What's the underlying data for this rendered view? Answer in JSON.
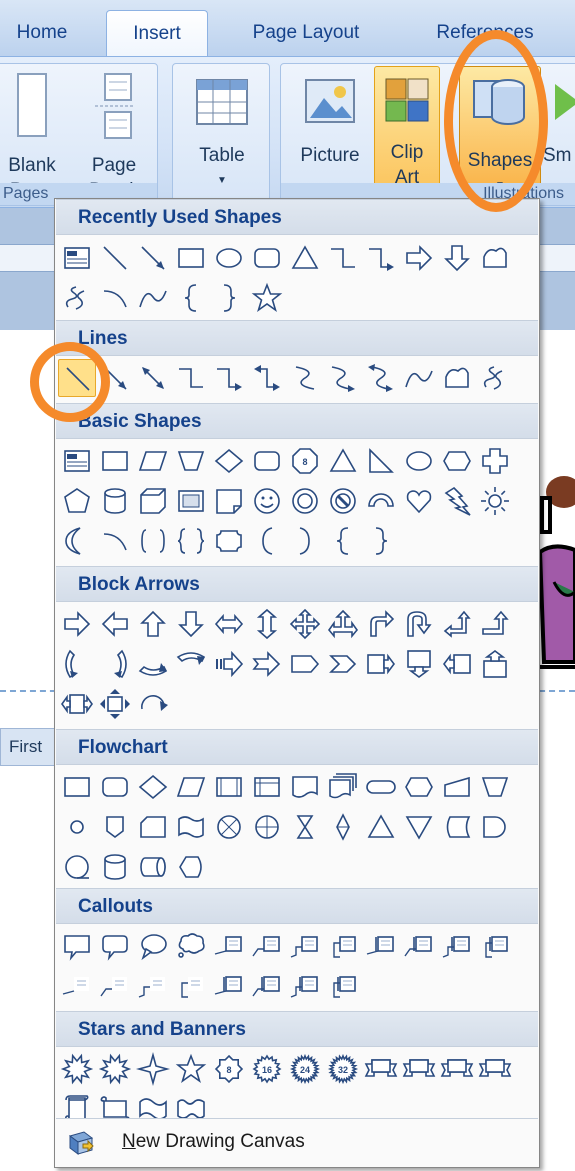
{
  "ribbon_tabs": [
    "Home",
    "Insert",
    "Page Layout",
    "References"
  ],
  "ribbon_groups": {
    "pages": {
      "label": "Pages",
      "buttons": [
        "Blank Page",
        "Page Break"
      ]
    },
    "tables": {
      "button": "Table"
    },
    "illustrations": {
      "label": "Illustrations",
      "buttons": [
        "Picture",
        "Clip Art",
        "Shapes",
        "Sm"
      ]
    }
  },
  "side_tab": "First",
  "shapes_menu": {
    "sections": [
      {
        "title": "Recently Used Shapes",
        "rows": [
          [
            "text-box",
            "line",
            "arrow",
            "rectangle",
            "oval",
            "rounded-rectangle",
            "triangle",
            "elbow-connector",
            "elbow-arrow-connector",
            "right-arrow",
            "down-arrow",
            "freeform"
          ],
          [
            "scribble",
            "arc",
            "curve",
            "left-brace",
            "right-brace",
            "star"
          ]
        ]
      },
      {
        "title": "Lines",
        "rows": [
          [
            "line",
            "arrow",
            "double-arrow",
            "elbow-connector",
            "elbow-arrow-connector",
            "elbow-double-arrow",
            "curved-connector",
            "curved-arrow-connector",
            "curved-double-arrow",
            "curve",
            "freeform",
            "scribble"
          ]
        ]
      },
      {
        "title": "Basic Shapes",
        "rows": [
          [
            "text-box",
            "rectangle",
            "parallelogram",
            "trapezoid",
            "diamond",
            "rounded-rectangle",
            "octagon",
            "isosceles-triangle",
            "right-triangle",
            "oval",
            "hexagon",
            "cross"
          ],
          [
            "pentagon",
            "can",
            "cube",
            "bevel",
            "folded-corner",
            "smiley-face",
            "donut",
            "no-symbol",
            "block-arc",
            "heart",
            "lightning-bolt",
            "sun"
          ],
          [
            "moon",
            "arc",
            "double-bracket",
            "double-brace",
            "plaque",
            "left-bracket",
            "right-bracket",
            "left-brace",
            "right-brace"
          ]
        ]
      },
      {
        "title": "Block Arrows",
        "rows": [
          [
            "right-arrow",
            "left-arrow",
            "up-arrow",
            "down-arrow",
            "left-right-arrow",
            "up-down-arrow",
            "quad-arrow",
            "left-right-up-arrow",
            "bent-arrow",
            "u-turn-arrow",
            "left-up-arrow",
            "bent-up-arrow"
          ],
          [
            "curved-right-arrow",
            "curved-left-arrow",
            "curved-up-arrow",
            "curved-down-arrow",
            "striped-right-arrow",
            "notched-right-arrow",
            "pentagon-arrow",
            "chevron",
            "right-arrow-callout",
            "down-arrow-callout",
            "left-arrow-callout",
            "up-arrow-callout"
          ],
          [
            "left-right-arrow-callout",
            "quad-arrow-callout",
            "circular-arrow"
          ]
        ]
      },
      {
        "title": "Flowchart",
        "rows": [
          [
            "process",
            "alternate-process",
            "decision",
            "data",
            "predefined-process",
            "internal-storage",
            "document",
            "multidocument",
            "terminator",
            "preparation",
            "manual-input",
            "manual-operation"
          ],
          [
            "connector",
            "off-page-connector",
            "card",
            "punched-tape",
            "summing-junction",
            "or",
            "collate",
            "sort",
            "extract",
            "merge",
            "stored-data",
            "delay"
          ],
          [
            "sequential-access-storage",
            "magnetic-disk",
            "direct-access-storage",
            "display"
          ]
        ]
      },
      {
        "title": "Callouts",
        "rows": [
          [
            "rectangular-callout",
            "rounded-rectangular-callout",
            "oval-callout",
            "cloud-callout",
            "line-callout-1",
            "line-callout-2",
            "line-callout-3",
            "line-callout-4",
            "line-callout-1-accent",
            "line-callout-2-accent",
            "line-callout-3-accent",
            "line-callout-4-accent"
          ],
          [
            "line-callout-1-no-border",
            "line-callout-2-no-border",
            "line-callout-3-no-border",
            "line-callout-4-no-border",
            "line-callout-1-border-accent",
            "line-callout-2-border-accent",
            "line-callout-3-border-accent",
            "line-callout-4-border-accent"
          ]
        ]
      },
      {
        "title": "Stars and Banners",
        "rows": [
          [
            "explosion-1",
            "explosion-2",
            "4-point-star",
            "5-point-star",
            "8-point-star",
            "16-point-star",
            "24-point-star",
            "32-point-star",
            "up-ribbon",
            "down-ribbon",
            "curved-up-ribbon",
            "curved-down-ribbon"
          ],
          [
            "vertical-scroll",
            "horizontal-scroll",
            "wave",
            "double-wave"
          ]
        ]
      }
    ],
    "star_labels": {
      "8-point-star": "8",
      "16-point-star": "16",
      "24-point-star": "24",
      "32-point-star": "32",
      "octagon": "8"
    },
    "footer_label": "New Drawing Canvas"
  },
  "colors": {
    "accent_ring": "#f58a2b",
    "section_header_text": "#15428b",
    "shape_stroke": "#2a4b80"
  }
}
